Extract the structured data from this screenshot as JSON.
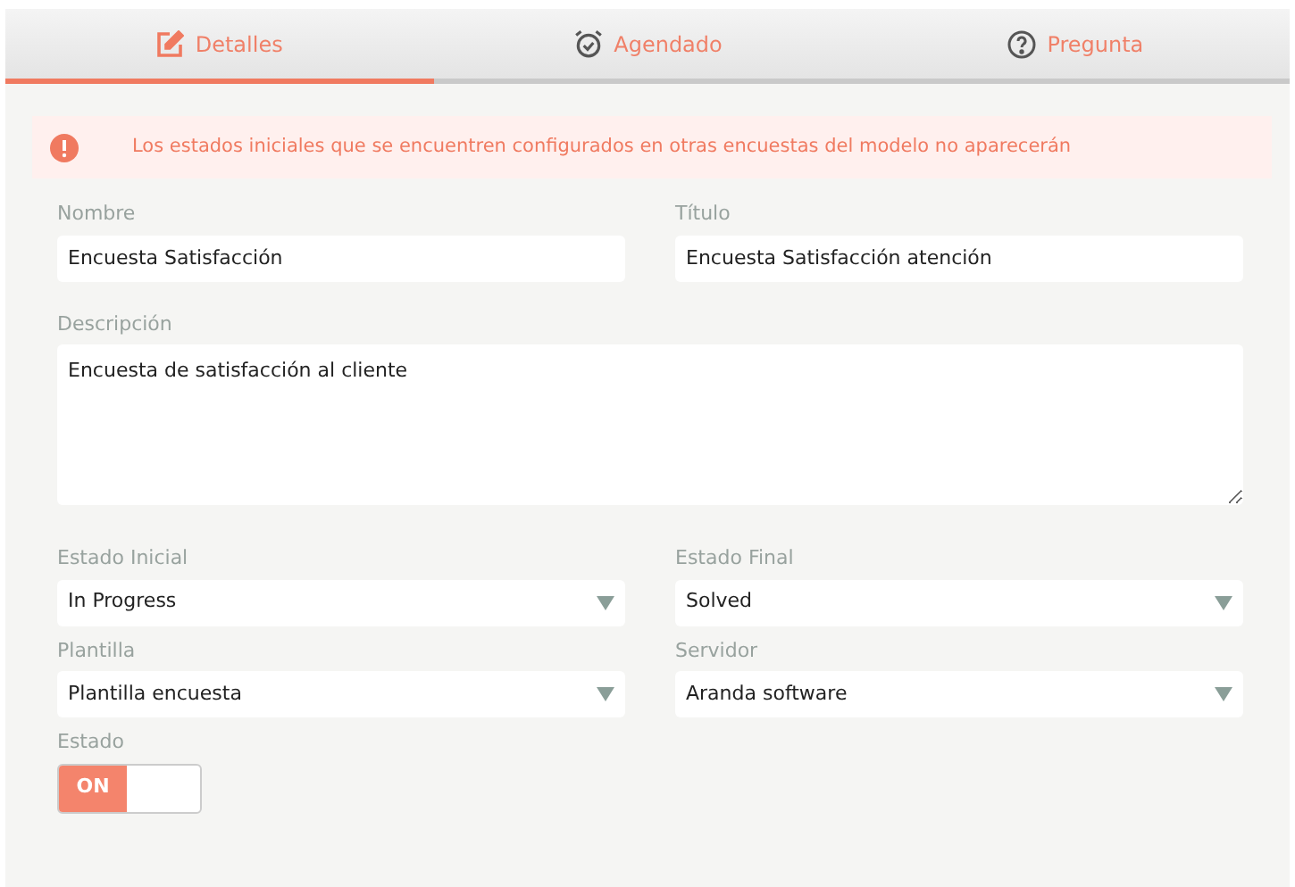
{
  "tabs": [
    {
      "label": "Detalles",
      "kind": "edit",
      "selected": true
    },
    {
      "label": "Agendado",
      "kind": "alarm",
      "selected": false
    },
    {
      "label": "Pregunta",
      "kind": "question",
      "selected": false
    }
  ],
  "alert": {
    "text": "Los estados iniciales que se encuentren configurados en otras encuestas del modelo no aparecerán"
  },
  "fields": [
    {
      "label": "Nombre",
      "kind": "text",
      "value": "Encuesta Satisfacción"
    },
    {
      "label": "Título",
      "kind": "text",
      "value": "Encuesta Satisfacción atención"
    },
    {
      "label": "Descripción",
      "kind": "textarea",
      "value": "Encuesta de satisfacción al cliente"
    },
    {
      "label": "Estado Inicial",
      "kind": "select",
      "value": "In Progress"
    },
    {
      "label": "Estado Final",
      "kind": "select",
      "value": "Solved"
    },
    {
      "label": "Plantilla",
      "kind": "select",
      "value": "Plantilla encuesta"
    },
    {
      "label": "Servidor",
      "kind": "select",
      "value": "Aranda software"
    }
  ],
  "estado": {
    "label": "Estado",
    "on": true,
    "on_text": "ON"
  }
}
